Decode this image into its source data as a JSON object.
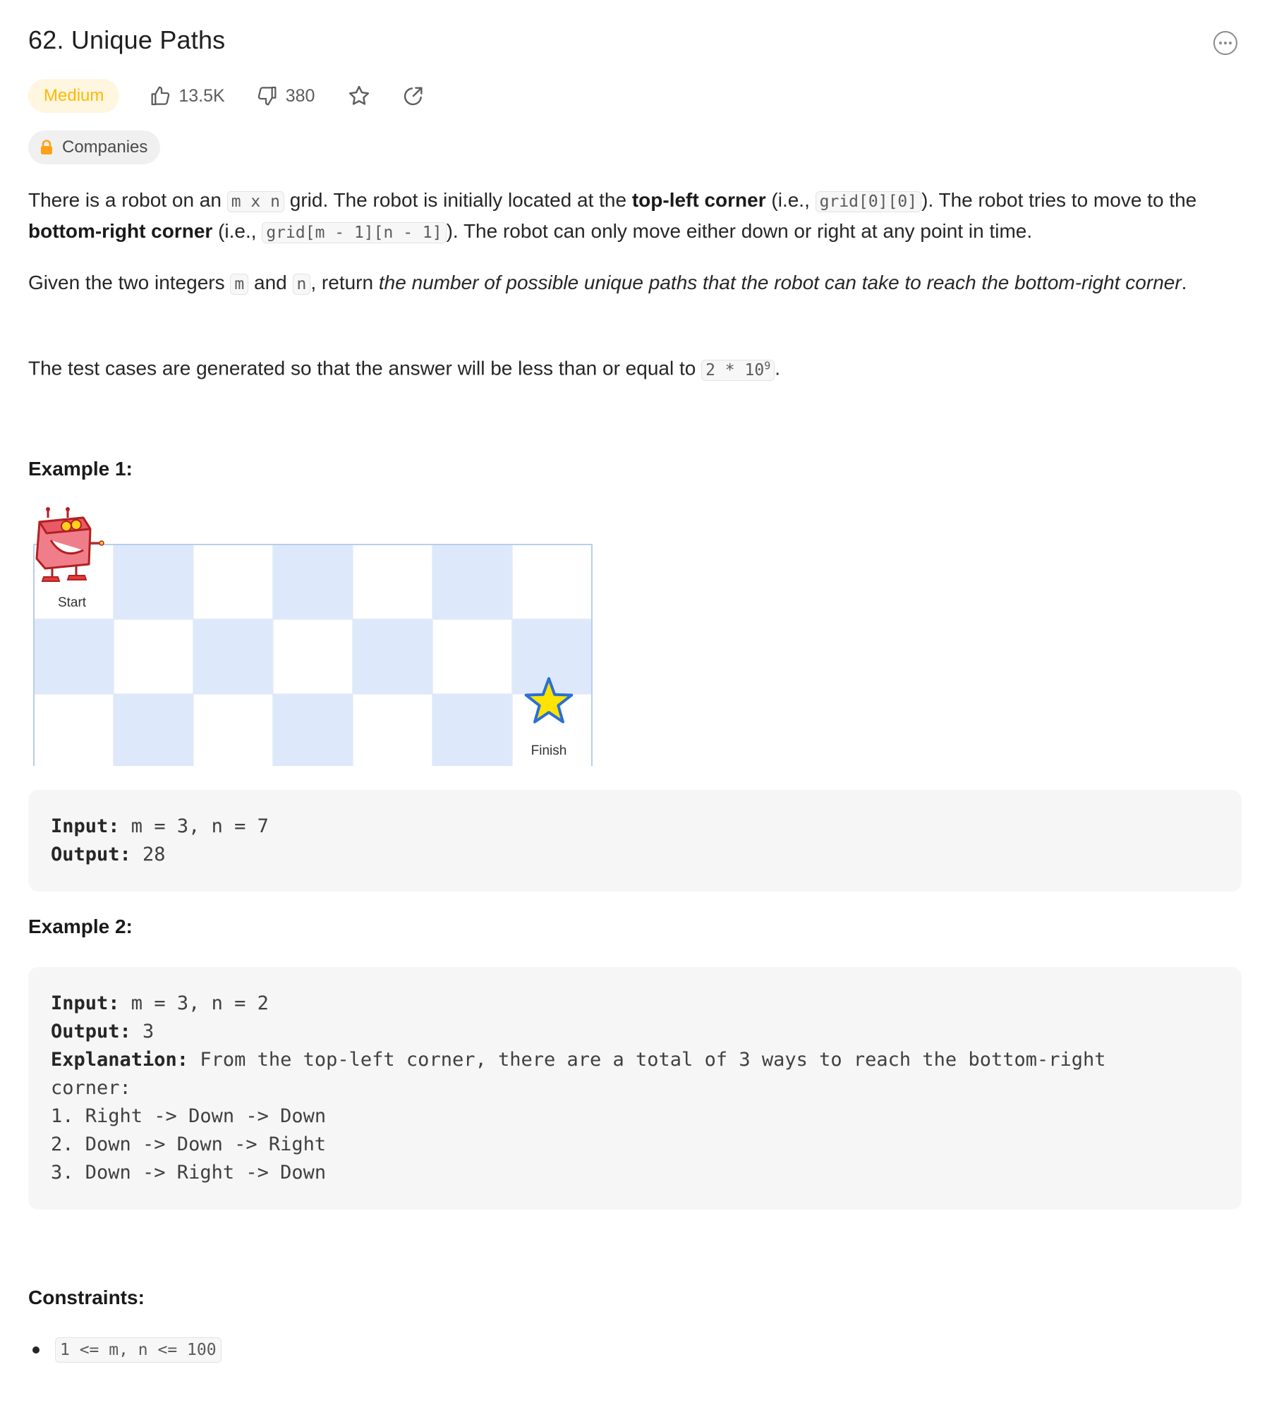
{
  "problem": {
    "title": "62. Unique Paths",
    "difficulty": "Medium",
    "likes": "13.5K",
    "dislikes": "380",
    "companies_label": "Companies"
  },
  "description": {
    "p1": {
      "t1": "There is a robot on an ",
      "c1": "m x n",
      "t2": " grid. The robot is initially located at the ",
      "b1": "top-left corner",
      "t3": " (i.e., ",
      "c2": "grid[0][0]",
      "t4": "). The robot tries to move to the ",
      "b2": "bottom-right corner",
      "t5": " (i.e., ",
      "c3": "grid[m - 1][n - 1]",
      "t6": "). The robot can only move either down or right at any point in time."
    },
    "p2": {
      "t1": "Given the two integers ",
      "c1": "m",
      "t2": " and ",
      "c2": "n",
      "t3": ", return ",
      "i1": "the number of possible unique paths that the robot can take to reach the bottom-right corner",
      "t4": "."
    },
    "p3": {
      "t1": "The test cases are generated so that the answer will be less than or equal to ",
      "c1": "2 * 10",
      "sup": "9",
      "t2": "."
    }
  },
  "example1": {
    "heading": "Example 1:",
    "figure": {
      "start_label": "Start",
      "finish_label": "Finish",
      "rows": 3,
      "cols": 7
    },
    "lines": [
      {
        "key": "Input:",
        "val": " m = 3, n = 7"
      },
      {
        "key": "Output:",
        "val": " 28"
      }
    ]
  },
  "example2": {
    "heading": "Example 2:",
    "lines": [
      {
        "key": "Input:",
        "val": " m = 3, n = 2"
      },
      {
        "key": "Output:",
        "val": " 3"
      },
      {
        "key": "Explanation:",
        "val": " From the top-left corner, there are a total of 3 ways to reach the bottom-right"
      },
      {
        "key": "",
        "val": "corner:"
      },
      {
        "key": "",
        "val": "1. Right -> Down -> Down"
      },
      {
        "key": "",
        "val": "2. Down -> Down -> Right"
      },
      {
        "key": "",
        "val": "3. Down -> Right -> Down"
      }
    ]
  },
  "constraints": {
    "heading": "Constraints:",
    "items": [
      "1 <= m, n <= 100"
    ]
  },
  "colors": {
    "medium_text": "#ffb800",
    "medium_bg": "#fff6e0",
    "grid_blue": "#dde8fb",
    "grid_border": "#b9cdf0",
    "star_fill": "#ffe400",
    "star_stroke": "#2b6fd6",
    "robot_red": "#e53a3a"
  },
  "icons": [
    "ellipsis-circle-icon",
    "thumbs-up-icon",
    "thumbs-down-icon",
    "star-icon",
    "share-icon",
    "lock-icon"
  ]
}
